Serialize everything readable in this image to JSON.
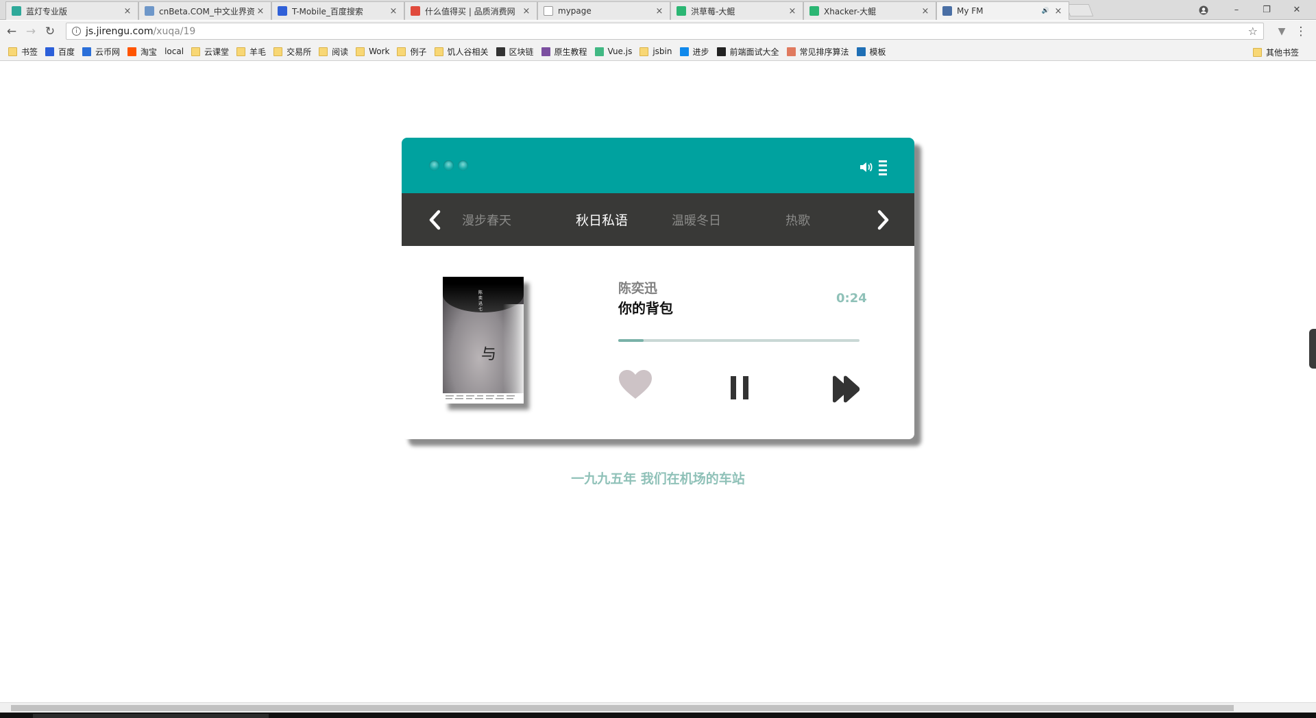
{
  "browser": {
    "tabs": [
      {
        "title": "蓝灯专业版",
        "favicon_color": "#2ea99a",
        "active": false
      },
      {
        "title": "cnBeta.COM_中文业界资",
        "favicon_color": "#6e97c9",
        "active": false
      },
      {
        "title": "T-Mobile_百度搜索",
        "favicon_color": "#3060d8",
        "active": false
      },
      {
        "title": "什么值得买 | 品质消费网",
        "favicon_color": "#e04a3c",
        "active": false
      },
      {
        "title": "mypage",
        "favicon_color": "#ffffff",
        "active": false
      },
      {
        "title": "洪草莓-大鲲",
        "favicon_color": "#2bb673",
        "active": false
      },
      {
        "title": "Xhacker-大鲲",
        "favicon_color": "#2bb673",
        "active": false
      },
      {
        "title": "My FM",
        "favicon_color": "#4a6fa5",
        "active": true
      }
    ],
    "address": {
      "host": "js.jirengu.com",
      "path": "/xuqa/19"
    },
    "bookmarks": [
      {
        "label": "书签",
        "icon": "folder"
      },
      {
        "label": "百度",
        "icon": "baidu"
      },
      {
        "label": "云币网",
        "icon": "link"
      },
      {
        "label": "淘宝",
        "icon": "taobao"
      },
      {
        "label": "local",
        "icon": "page"
      },
      {
        "label": "云课堂",
        "icon": "folder"
      },
      {
        "label": "羊毛",
        "icon": "folder"
      },
      {
        "label": "交易所",
        "icon": "folder"
      },
      {
        "label": "阅读",
        "icon": "folder"
      },
      {
        "label": "Work",
        "icon": "folder"
      },
      {
        "label": "例子",
        "icon": "folder"
      },
      {
        "label": "饥人谷相关",
        "icon": "folder"
      },
      {
        "label": "区块链",
        "icon": "block"
      },
      {
        "label": "原生教程",
        "icon": "book"
      },
      {
        "label": "Vue.js",
        "icon": "vue"
      },
      {
        "label": "jsbin",
        "icon": "folder"
      },
      {
        "label": "进步",
        "icon": "zhi"
      },
      {
        "label": "前端面试大全",
        "icon": "github"
      },
      {
        "label": "常见排序算法",
        "icon": "sort"
      },
      {
        "label": "模板",
        "icon": "mo"
      }
    ],
    "other_bookmarks": "其他书签"
  },
  "player": {
    "header_color": "#00a29f",
    "channels_bg": "#393937",
    "channels": [
      {
        "label": "漫步春天",
        "active": false
      },
      {
        "label": "秋日私语",
        "active": true
      },
      {
        "label": "温暖冬日",
        "active": false
      },
      {
        "label": "热歌",
        "active": false
      }
    ],
    "artist": "陈奕迅",
    "song": "你的背包",
    "time": "0:24",
    "progress_fraction": 0.105,
    "cover_glyph": "与",
    "cover_vertical_text": "陈奕迅七",
    "liked": false
  },
  "lyric": "一九九五年 我们在机场的车站"
}
